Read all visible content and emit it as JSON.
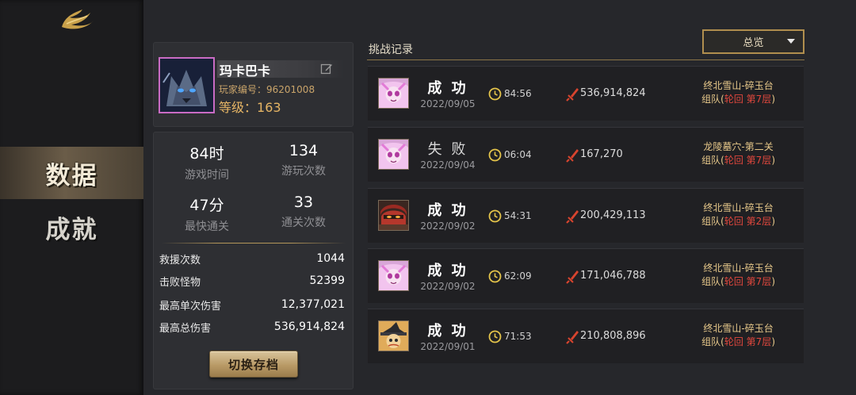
{
  "nav": {
    "items": [
      {
        "label": "数据",
        "active": true
      },
      {
        "label": "成就",
        "active": false
      }
    ]
  },
  "profile": {
    "name": "玛卡巴卡",
    "player_id": "玩家编号：96201008",
    "level_label": "等级：",
    "level": "163"
  },
  "stats": {
    "top": [
      {
        "value": "84时",
        "label": "游戏时间"
      },
      {
        "value": "134",
        "label": "游玩次数"
      },
      {
        "value": "47分",
        "label": "最快通关"
      },
      {
        "value": "33",
        "label": "通关次数"
      }
    ],
    "details": [
      {
        "label": "救援次数",
        "value": "1044"
      },
      {
        "label": "击败怪物",
        "value": "52399"
      },
      {
        "label": "最高单次伤害",
        "value": "12,377,021"
      },
      {
        "label": "最高总伤害",
        "value": "536,914,824"
      }
    ],
    "switch_button": "切换存档"
  },
  "records": {
    "title": "挑战记录",
    "filter": "总览",
    "items": [
      {
        "result": "成 功",
        "date": "2022/09/05",
        "time": "84:56",
        "damage": "536,914,824",
        "map": "终北雪山-碎玉台",
        "mode_prefix": "组队(",
        "mode_hl": "轮回 第7层",
        "mode_suffix": ")",
        "avatar": "pink"
      },
      {
        "result": "失 败",
        "date": "2022/09/04",
        "time": "06:04",
        "damage": "167,270",
        "map": "龙陵墓穴-第二关",
        "mode_prefix": "组队(",
        "mode_hl": "轮回 第7层",
        "mode_suffix": ")",
        "avatar": "pink"
      },
      {
        "result": "成 功",
        "date": "2022/09/02",
        "time": "54:31",
        "damage": "200,429,113",
        "map": "终北雪山-碎玉台",
        "mode_prefix": "组队(",
        "mode_hl": "轮回 第2层",
        "mode_suffix": ")",
        "avatar": "red"
      },
      {
        "result": "成 功",
        "date": "2022/09/02",
        "time": "62:09",
        "damage": "171,046,788",
        "map": "终北雪山-碎玉台",
        "mode_prefix": "组队(",
        "mode_hl": "轮回 第7层",
        "mode_suffix": ")",
        "avatar": "pink"
      },
      {
        "result": "成 功",
        "date": "2022/09/01",
        "time": "71:53",
        "damage": "210,808,896",
        "map": "终北雪山-碎玉台",
        "mode_prefix": "组队(",
        "mode_hl": "轮回 第7层",
        "mode_suffix": ")",
        "avatar": "witch"
      }
    ]
  },
  "colors": {
    "accent_gold": "#b08e4e",
    "highlight_red": "#e0473d",
    "avatar_frame": "#c96bc4"
  }
}
